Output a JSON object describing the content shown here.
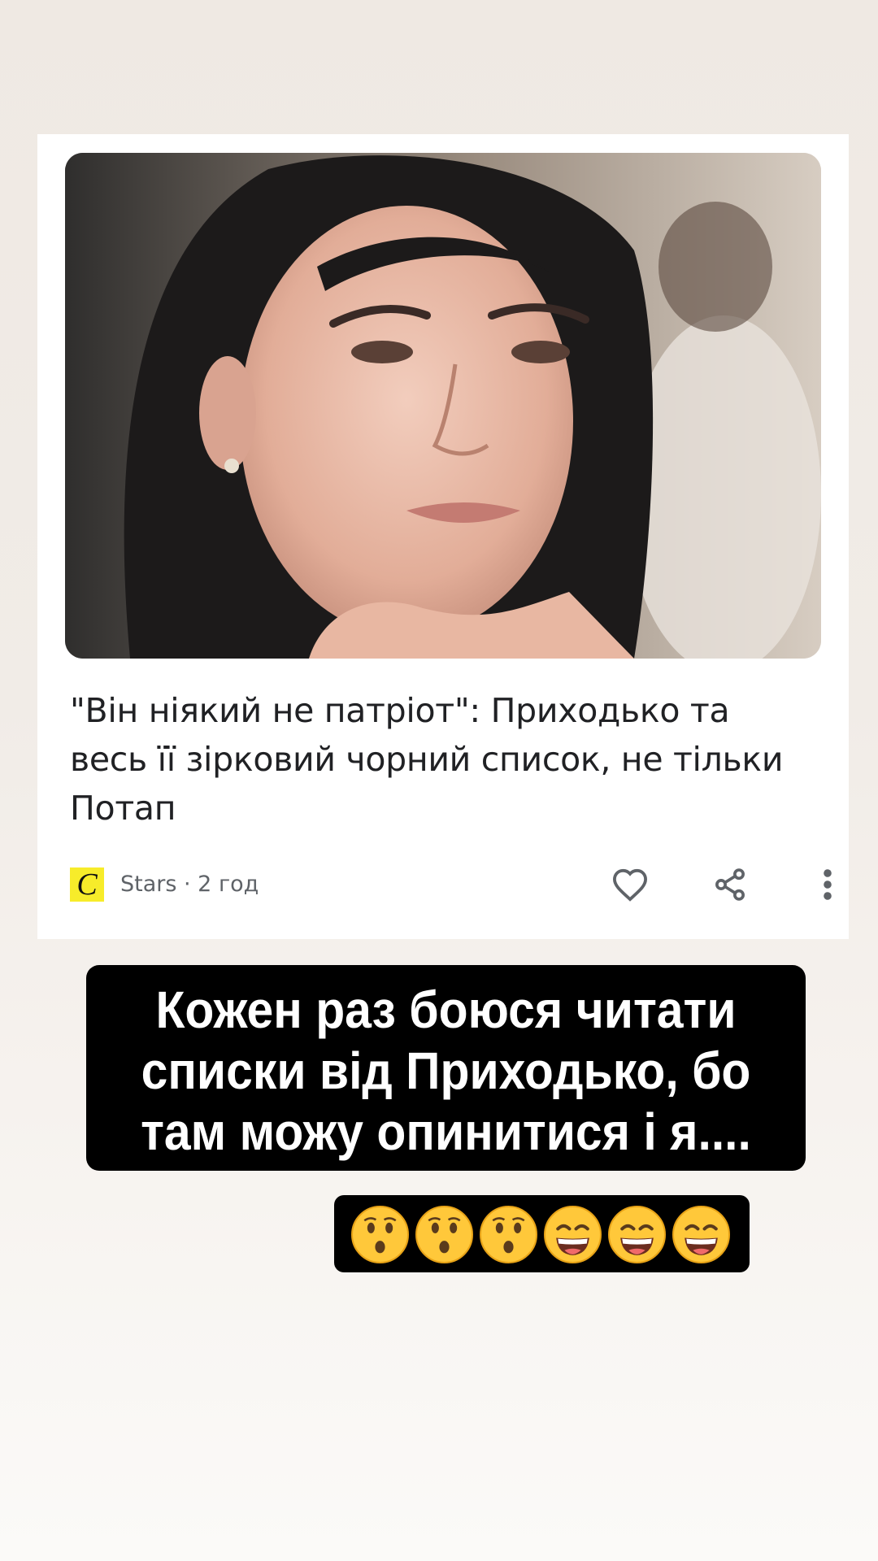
{
  "article": {
    "headline": "\"Він ніякий не патріот\": Приходько та весь її зірковий чорний список, не тільки Потап",
    "source_logo_letter": "C",
    "source_line": "Stars · 2 год",
    "icons": [
      "heart-icon",
      "share-icon",
      "more-vert-icon"
    ]
  },
  "story_caption": {
    "text": "Кожен раз боюся читати списки від Приходько, бо там можу опинитися і я...."
  },
  "emoji_row": {
    "items": [
      "hushed-face-emoji",
      "hushed-face-emoji",
      "hushed-face-emoji",
      "grinning-face-emoji",
      "grinning-face-emoji",
      "grinning-face-emoji"
    ]
  },
  "colors": {
    "background": "#efe9e3",
    "card": "#ffffff",
    "headline_text": "#202124",
    "meta_text": "#5f6368",
    "source_logo_bg": "#f7ec2a",
    "caption_bg": "#000000",
    "caption_text": "#ffffff",
    "emoji_yellow": "#ffc83a"
  }
}
